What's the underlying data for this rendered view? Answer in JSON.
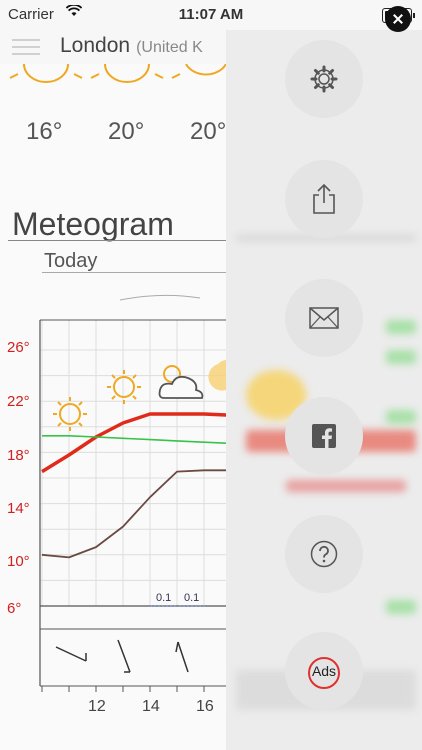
{
  "status": {
    "carrier": "Carrier",
    "time": "11:07 AM"
  },
  "header": {
    "city": "London",
    "country": "(United K"
  },
  "forecast": {
    "temps": [
      "16°",
      "20°",
      "20°"
    ]
  },
  "meteogram": {
    "title": "Meteogram",
    "day_label": "Today",
    "chart_data": {
      "type": "line",
      "x_tick_labels": [
        "12",
        "14",
        "16"
      ],
      "y_tick_labels": [
        "26°",
        "22°",
        "18°",
        "14°",
        "10°",
        "6°"
      ],
      "ylim": [
        6,
        26
      ],
      "x": [
        10,
        11,
        12,
        13,
        14,
        15,
        16,
        17
      ],
      "series": [
        {
          "values": [
            16.5,
            17.8,
            19.2,
            20.3,
            21.0,
            21.0,
            21.0,
            20.9
          ]
        },
        {
          "values": [
            19.3,
            19.3,
            19.2,
            19.1,
            19.0,
            18.9,
            18.8,
            18.7
          ]
        },
        {
          "values": [
            10.0,
            9.8,
            10.6,
            12.2,
            14.5,
            16.5,
            16.6,
            16.6
          ]
        }
      ],
      "precipitation_labels": [
        "0.1",
        "0.1"
      ]
    }
  },
  "colors": {
    "temperature": "#e02a1a",
    "dewpoint": "#39c24a",
    "other": "#6b4a40",
    "axis_label": "#d02020"
  },
  "side_menu": {
    "items": [
      {
        "name": "settings",
        "icon": "gear-icon"
      },
      {
        "name": "share",
        "icon": "share-icon"
      },
      {
        "name": "mail",
        "icon": "envelope-icon"
      },
      {
        "name": "facebook",
        "icon": "facebook-icon"
      },
      {
        "name": "help",
        "icon": "question-icon"
      },
      {
        "name": "remove-ads",
        "icon": "no-ads-icon"
      }
    ],
    "ads_label": "Ads"
  }
}
